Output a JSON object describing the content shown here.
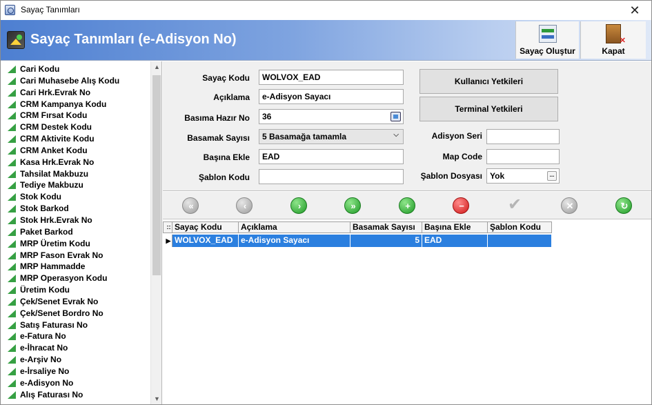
{
  "window": {
    "title": "Sayaç Tanımları",
    "close_glyph": "✕"
  },
  "header": {
    "title": "Sayaç Tanımları (e-Adisyon No)",
    "create_label": "Sayaç Oluştur",
    "close_label": "Kapat"
  },
  "sidebar": {
    "items": [
      "Cari Kodu",
      "Cari Muhasebe Alış Kodu",
      "Cari Hrk.Evrak No",
      "CRM Kampanya Kodu",
      "CRM Fırsat Kodu",
      "CRM Destek Kodu",
      "CRM Aktivite Kodu",
      "CRM Anket Kodu",
      "Kasa Hrk.Evrak No",
      "Tahsilat Makbuzu",
      "Tediye Makbuzu",
      "Stok Kodu",
      "Stok Barkod",
      "Stok Hrk.Evrak No",
      "Paket Barkod",
      "MRP Üretim Kodu",
      "MRP Fason Evrak No",
      "MRP Hammadde",
      "MRP Operasyon Kodu",
      "Üretim Kodu",
      "Çek/Senet Evrak No",
      "Çek/Senet Bordro No",
      "Satış Faturası No",
      "e-Fatura No",
      "e-İhracat No",
      "e-Arşiv No",
      "e-İrsaliye No",
      "e-Adisyon No",
      "Alış Faturası No"
    ],
    "scroll_up": "▲",
    "scroll_down": "▼"
  },
  "form": {
    "sayac_kodu_label": "Sayaç Kodu",
    "sayac_kodu_value": "WOLVOX_EAD",
    "aciklama_label": "Açıklama",
    "aciklama_value": "e-Adisyon Sayacı",
    "basima_hazir_label": "Basıma Hazır No",
    "basima_hazir_value": "36",
    "basamak_sayisi_label": "Basamak Sayısı",
    "basamak_sayisi_value": "5 Basamağa tamamla",
    "basina_ekle_label": "Başına Ekle",
    "basina_ekle_value": "EAD",
    "sablon_kodu_label": "Şablon Kodu",
    "sablon_kodu_value": "",
    "kullanici_yetkileri": "Kullanıcı Yetkileri",
    "terminal_yetkileri": "Terminal Yetkileri",
    "adisyon_seri_label": "Adisyon Seri",
    "adisyon_seri_value": "",
    "map_code_label": "Map Code",
    "map_code_value": "",
    "sablon_dosyasi_label": "Şablon Dosyası",
    "sablon_dosyasi_value": "Yok",
    "ellipsis": "..."
  },
  "grid": {
    "columns": [
      "Sayaç Kodu",
      "Açıklama",
      "Basamak Sayısı",
      "Başına Ekle",
      "Şablon Kodu"
    ],
    "header_indicator": "::",
    "row_indicator": "▶",
    "rows": [
      {
        "sayac_kodu": "WOLVOX_EAD",
        "aciklama": "e-Adisyon Sayacı",
        "basamak_sayisi": "5",
        "basina_ekle": "EAD",
        "sablon_kodu": ""
      }
    ]
  },
  "icons": {
    "nav_first": "first-record-icon",
    "nav_prev": "previous-record-icon",
    "nav_next": "next-record-icon",
    "nav_last": "last-record-icon",
    "add": "add-record-icon",
    "delete": "delete-record-icon",
    "post": "post-check-icon",
    "cancel": "cancel-edit-icon",
    "refresh": "refresh-icon"
  },
  "colors": {
    "header_gradient_start": "#4d7fd1",
    "selection": "#2b7fdf",
    "tree_icon": "#36a043"
  }
}
